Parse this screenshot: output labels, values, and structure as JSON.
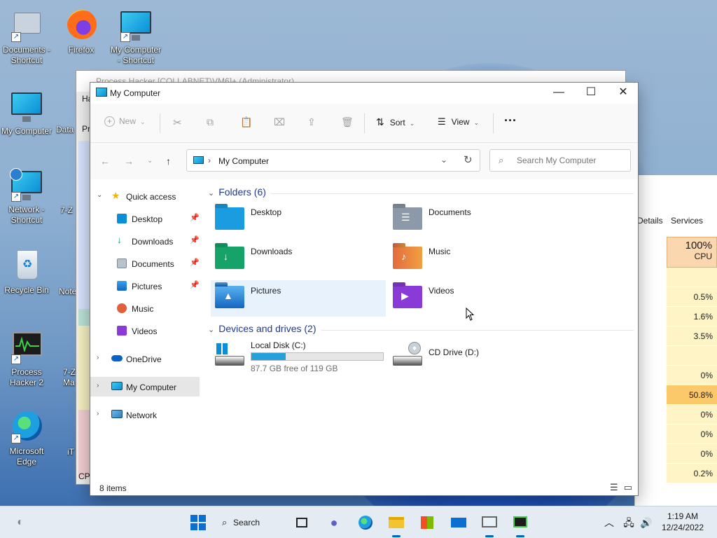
{
  "desktop": {
    "icons": [
      {
        "label": "Documents - Shortcut",
        "icon": "documents-icon"
      },
      {
        "label": "Firefox",
        "icon": "firefox-icon"
      },
      {
        "label": "My Computer - Shortcut",
        "icon": "computer-icon"
      },
      {
        "label": "My Computer",
        "icon": "computer-icon"
      },
      {
        "label": "Data",
        "icon": "app-icon"
      },
      {
        "label": "Network - Shortcut",
        "icon": "network-icon"
      },
      {
        "label": "7-Z",
        "icon": "archive-icon"
      },
      {
        "label": "Recycle Bin",
        "icon": "recycle-bin-icon"
      },
      {
        "label": "Note",
        "icon": "notepad-icon"
      },
      {
        "label": "Process Hacker 2",
        "icon": "process-hacker-icon"
      },
      {
        "label": "7-Z Ma",
        "icon": "archive-icon"
      },
      {
        "label": "Microsoft Edge",
        "icon": "edge-icon"
      },
      {
        "label": "iT",
        "icon": "app-icon"
      }
    ]
  },
  "background_windows": {
    "process_hacker": {
      "title": "Process Hacker [COLLABNET\\VM6]+ (Administrator)",
      "fragments": [
        "Ha",
        "Pro",
        "N",
        "CPU"
      ]
    },
    "task_manager": {
      "tabs": [
        "Details",
        "Services"
      ],
      "cpu_header": {
        "percent": "100%",
        "label": "CPU"
      },
      "cpu_values": [
        "",
        "0.5%",
        "1.6%",
        "3.5%",
        "",
        "0%",
        "50.8%",
        "0%",
        "0%",
        "0%",
        "0.2%"
      ],
      "highlight_color": "#fcc96a"
    }
  },
  "explorer": {
    "title": "My Computer",
    "window_controls": {
      "minimize": "—",
      "maximize": "☐",
      "close": "✕"
    },
    "toolbar": {
      "new_label": "New",
      "sort_label": "Sort",
      "view_label": "View",
      "more_label": "···"
    },
    "address": {
      "path": "My Computer",
      "search_placeholder": "Search My Computer"
    },
    "nav": {
      "quick_access": "Quick access",
      "quick_items": [
        {
          "label": "Desktop",
          "icon": "desktop-icon",
          "color": "#0a8fd6"
        },
        {
          "label": "Downloads",
          "icon": "downloads-icon",
          "color": "#1aa260"
        },
        {
          "label": "Documents",
          "icon": "documents-icon",
          "color": "#8b99a8"
        },
        {
          "label": "Pictures",
          "icon": "pictures-icon",
          "color": "#1f7fd8"
        },
        {
          "label": "Music",
          "icon": "music-icon",
          "color": "#e0603a"
        },
        {
          "label": "Videos",
          "icon": "videos-icon",
          "color": "#8a3ad6"
        }
      ],
      "onedrive": "OneDrive",
      "this_pc": "My Computer",
      "network": "Network"
    },
    "folders_header": "Folders (6)",
    "folders": [
      {
        "name": "Desktop",
        "color": "#1c9ce0"
      },
      {
        "name": "Documents",
        "color": "#8b99a8"
      },
      {
        "name": "Downloads",
        "color": "#16a36a"
      },
      {
        "name": "Music",
        "color": "#e46a3e"
      },
      {
        "name": "Pictures",
        "color": "#2b86d8"
      },
      {
        "name": "Videos",
        "color": "#8a3ad6"
      }
    ],
    "devices_header": "Devices and drives (2)",
    "drives": [
      {
        "name": "Local Disk (C:)",
        "free": "87.7 GB free of 119 GB",
        "used_fraction": 0.263
      },
      {
        "name": "CD Drive (D:)"
      }
    ],
    "status": {
      "item_count": "8 items"
    }
  },
  "taskbar": {
    "search_label": "Search",
    "clock_time": "1:19 AM",
    "clock_date": "12/24/2022"
  }
}
